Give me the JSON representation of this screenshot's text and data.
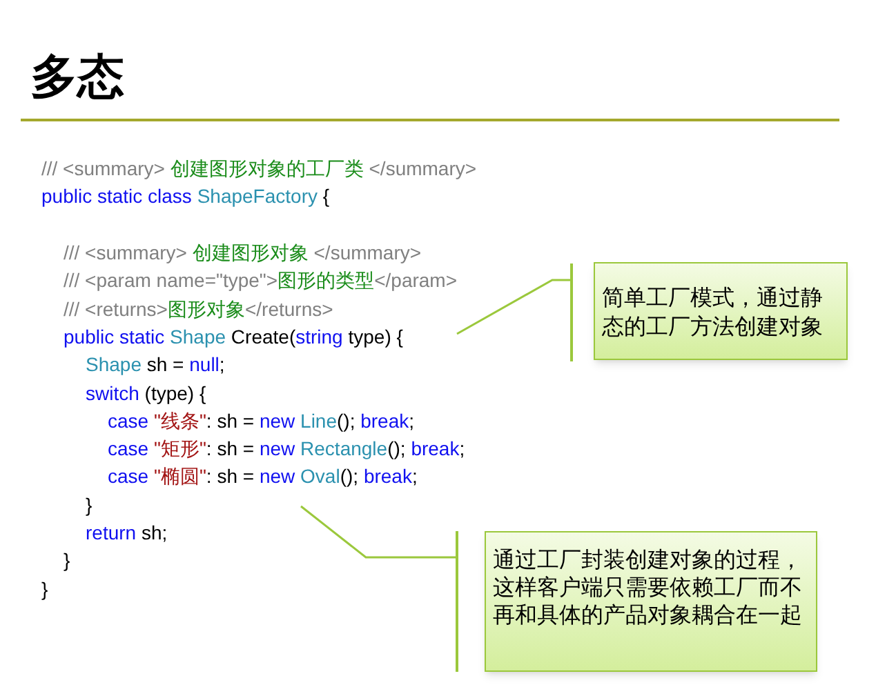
{
  "title": "多态",
  "code": [
    {
      "tokens": [
        {
          "kind": "comment",
          "text": "/// <summary> "
        },
        {
          "kind": "doc",
          "text": "创建图形对象的工厂类"
        },
        {
          "kind": "comment",
          "text": " </summary>"
        }
      ]
    },
    {
      "tokens": [
        {
          "kind": "keyword",
          "text": "public static class "
        },
        {
          "kind": "type",
          "text": "ShapeFactory"
        },
        {
          "kind": "plain",
          "text": " {"
        }
      ],
      "children": [
        {
          "blank_line_before": true,
          "tokens": [
            {
              "kind": "comment",
              "text": "/// <summary> "
            },
            {
              "kind": "doc",
              "text": "创建图形对象"
            },
            {
              "kind": "comment",
              "text": " </summary>"
            }
          ]
        },
        {
          "tokens": [
            {
              "kind": "comment",
              "text": "/// <param name=\"type\">"
            },
            {
              "kind": "doc",
              "text": "图形的类型"
            },
            {
              "kind": "comment",
              "text": "</param>"
            }
          ]
        },
        {
          "tokens": [
            {
              "kind": "comment",
              "text": "/// <returns>"
            },
            {
              "kind": "doc",
              "text": "图形对象"
            },
            {
              "kind": "comment",
              "text": "</returns>"
            }
          ]
        },
        {
          "tokens": [
            {
              "kind": "keyword",
              "text": "public static "
            },
            {
              "kind": "type",
              "text": "Shape"
            },
            {
              "kind": "plain",
              "text": " Create("
            },
            {
              "kind": "keyword",
              "text": "string"
            },
            {
              "kind": "plain",
              "text": " type) {"
            }
          ],
          "children": [
            {
              "tokens": [
                {
                  "kind": "type",
                  "text": "Shape"
                },
                {
                  "kind": "plain",
                  "text": " sh = "
                },
                {
                  "kind": "keyword",
                  "text": "null"
                },
                {
                  "kind": "plain",
                  "text": ";"
                }
              ]
            },
            {
              "tokens": [
                {
                  "kind": "keyword",
                  "text": "switch"
                },
                {
                  "kind": "plain",
                  "text": " (type) {"
                }
              ],
              "children": [
                {
                  "tokens": [
                    {
                      "kind": "keyword",
                      "text": "case "
                    },
                    {
                      "kind": "string",
                      "text": "\"线条\""
                    },
                    {
                      "kind": "plain",
                      "text": ": sh = "
                    },
                    {
                      "kind": "keyword",
                      "text": "new "
                    },
                    {
                      "kind": "type",
                      "text": "Line"
                    },
                    {
                      "kind": "plain",
                      "text": "(); "
                    },
                    {
                      "kind": "keyword",
                      "text": "break"
                    },
                    {
                      "kind": "plain",
                      "text": ";"
                    }
                  ]
                },
                {
                  "tokens": [
                    {
                      "kind": "keyword",
                      "text": "case "
                    },
                    {
                      "kind": "string",
                      "text": "\"矩形\""
                    },
                    {
                      "kind": "plain",
                      "text": ": sh = "
                    },
                    {
                      "kind": "keyword",
                      "text": "new "
                    },
                    {
                      "kind": "type",
                      "text": "Rectangle"
                    },
                    {
                      "kind": "plain",
                      "text": "(); "
                    },
                    {
                      "kind": "keyword",
                      "text": "break"
                    },
                    {
                      "kind": "plain",
                      "text": ";"
                    }
                  ]
                },
                {
                  "tokens": [
                    {
                      "kind": "keyword",
                      "text": "case "
                    },
                    {
                      "kind": "string",
                      "text": "\"椭圆\""
                    },
                    {
                      "kind": "plain",
                      "text": ": sh = "
                    },
                    {
                      "kind": "keyword",
                      "text": "new "
                    },
                    {
                      "kind": "type",
                      "text": "Oval"
                    },
                    {
                      "kind": "plain",
                      "text": "(); "
                    },
                    {
                      "kind": "keyword",
                      "text": "break"
                    },
                    {
                      "kind": "plain",
                      "text": ";"
                    }
                  ]
                }
              ]
            },
            {
              "tokens": [
                {
                  "kind": "plain",
                  "text": "}"
                }
              ]
            },
            {
              "tokens": [
                {
                  "kind": "keyword",
                  "text": "return"
                },
                {
                  "kind": "plain",
                  "text": " sh;"
                }
              ]
            }
          ]
        },
        {
          "tokens": [
            {
              "kind": "plain",
              "text": "}"
            }
          ]
        }
      ]
    },
    {
      "tokens": [
        {
          "kind": "plain",
          "text": "}"
        }
      ]
    }
  ],
  "callouts": [
    "简单工厂模式，通过静态的工厂方法创建对象",
    "通过工厂封装创建对象的过程，这样客户端只需要依赖工厂而不再和具体的产品对象耦合在一起"
  ]
}
